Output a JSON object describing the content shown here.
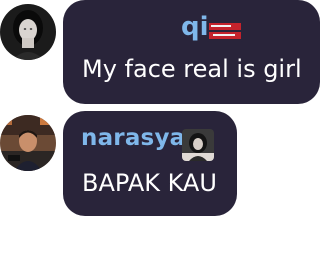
{
  "messages": [
    {
      "username": "qi",
      "text": "My face real is girl",
      "name_color": "#7fb7ea",
      "avatar_icon": "user-avatar-dark-hair"
    },
    {
      "username": "narasya",
      "text": "BAPAK KAU",
      "name_color": "#7fb7ea",
      "avatar_icon": "user-avatar-man-studio"
    }
  ],
  "colors": {
    "bubble_bg": "#29243a",
    "message_text": "#ffffff",
    "page_bg": "#ffffff"
  }
}
